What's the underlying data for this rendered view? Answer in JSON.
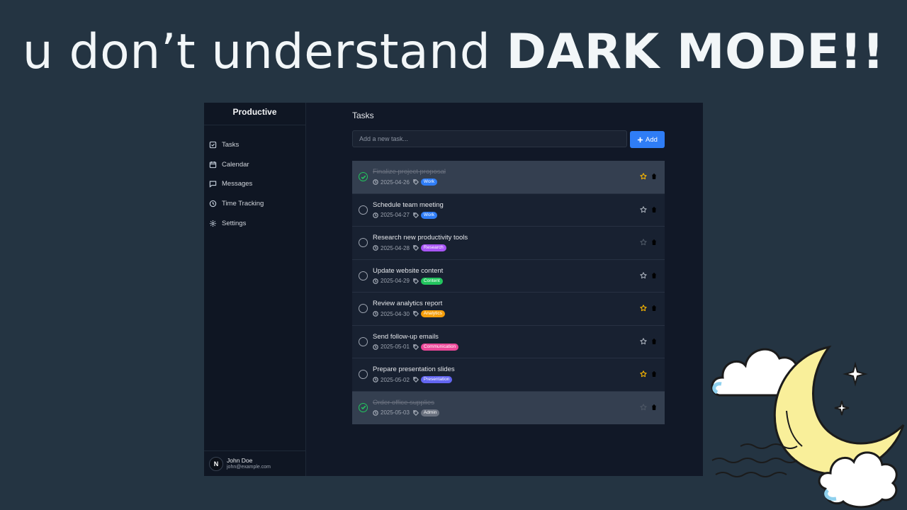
{
  "headline": {
    "regular": "u don’t understand ",
    "bold": "DARK MODE!!"
  },
  "app": {
    "brand": "Productive",
    "nav": [
      {
        "label": "Tasks",
        "icon": "check-square-icon"
      },
      {
        "label": "Calendar",
        "icon": "calendar-icon"
      },
      {
        "label": "Messages",
        "icon": "message-icon"
      },
      {
        "label": "Time Tracking",
        "icon": "clock-icon"
      },
      {
        "label": "Settings",
        "icon": "gear-icon"
      }
    ],
    "user": {
      "initial": "N",
      "name": "John Doe",
      "email": "john@example.com"
    },
    "page_title": "Tasks",
    "input_placeholder": "Add a new task...",
    "add_label": "Add",
    "tasks": [
      {
        "title": "Finalize project proposal",
        "date": "2025-04-26",
        "tag": "Work",
        "tag_color": "#2f7df6",
        "done": true,
        "starred": true
      },
      {
        "title": "Schedule team meeting",
        "date": "2025-04-27",
        "tag": "Work",
        "tag_color": "#2f7df6",
        "done": false,
        "starred": false
      },
      {
        "title": "Research new productivity tools",
        "date": "2025-04-28",
        "tag": "Research",
        "tag_color": "#a855f7",
        "done": false,
        "starred": false,
        "star_muted": true
      },
      {
        "title": "Update website content",
        "date": "2025-04-29",
        "tag": "Content",
        "tag_color": "#22c55e",
        "done": false,
        "starred": false
      },
      {
        "title": "Review analytics report",
        "date": "2025-04-30",
        "tag": "Analytics",
        "tag_color": "#f59e0b",
        "done": false,
        "starred": true
      },
      {
        "title": "Send follow-up emails",
        "date": "2025-05-01",
        "tag": "Communication",
        "tag_color": "#ec4899",
        "done": false,
        "starred": false
      },
      {
        "title": "Prepare presentation slides",
        "date": "2025-05-02",
        "tag": "Presentation",
        "tag_color": "#6366f1",
        "done": false,
        "starred": true
      },
      {
        "title": "Order office supplies",
        "date": "2025-05-03",
        "tag": "Admin",
        "tag_color": "#6b7280",
        "done": true,
        "starred": false,
        "star_muted": true
      }
    ]
  },
  "colors": {
    "background": "#243442",
    "accent": "#2f7df6",
    "star": "#f5b301",
    "done": "#22c55e"
  }
}
